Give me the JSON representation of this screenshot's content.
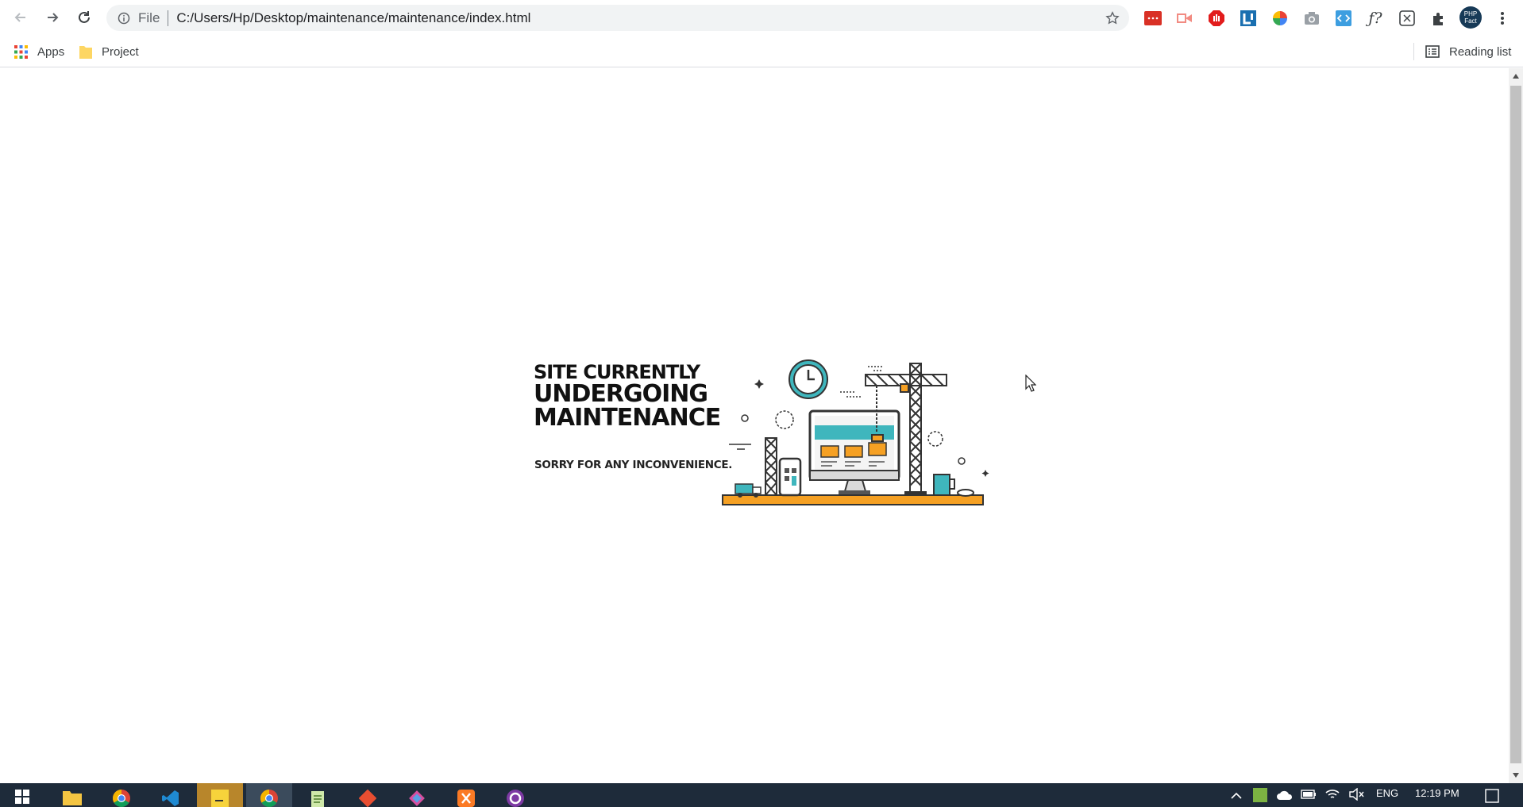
{
  "browser": {
    "url_scheme": "File",
    "url": "C:/Users/Hp/Desktop/maintenance/maintenance/index.html",
    "bookmarks": [
      {
        "label": "Apps",
        "icon": "apps-grid-icon"
      },
      {
        "label": "Project",
        "icon": "folder-icon"
      }
    ],
    "reading_list_label": "Reading list",
    "extensions": [
      "pdf-extension-icon",
      "screencast-extension-icon",
      "adblock-extension-icon",
      "lingq-extension-icon",
      "color-picker-icon",
      "screenshot-icon",
      "code-extension-icon",
      "fx-extension-icon",
      "grid-extension-icon",
      "puzzle-icon",
      "profile-avatar-icon",
      "menu-kebab-icon"
    ],
    "avatar_text": "PHP Fact"
  },
  "page": {
    "headline_line1": "SITE CURRENTLY",
    "headline_line2": "UNDERGOING",
    "headline_line3": "MAINTENANCE",
    "subline": "SORRY FOR ANY INCONVENIENCE.",
    "accent_color": "#f5a023",
    "teal_color": "#3fb6bd"
  },
  "taskbar": {
    "apps": [
      "windows-start-icon",
      "file-explorer-icon",
      "chrome-icon",
      "vscode-icon",
      "sticky-notes-icon",
      "chrome-active-icon",
      "notepad-icon",
      "git-icon",
      "app-icon",
      "xampp-icon",
      "github-desktop-icon"
    ],
    "language": "ENG",
    "time": "12:19 PM"
  }
}
